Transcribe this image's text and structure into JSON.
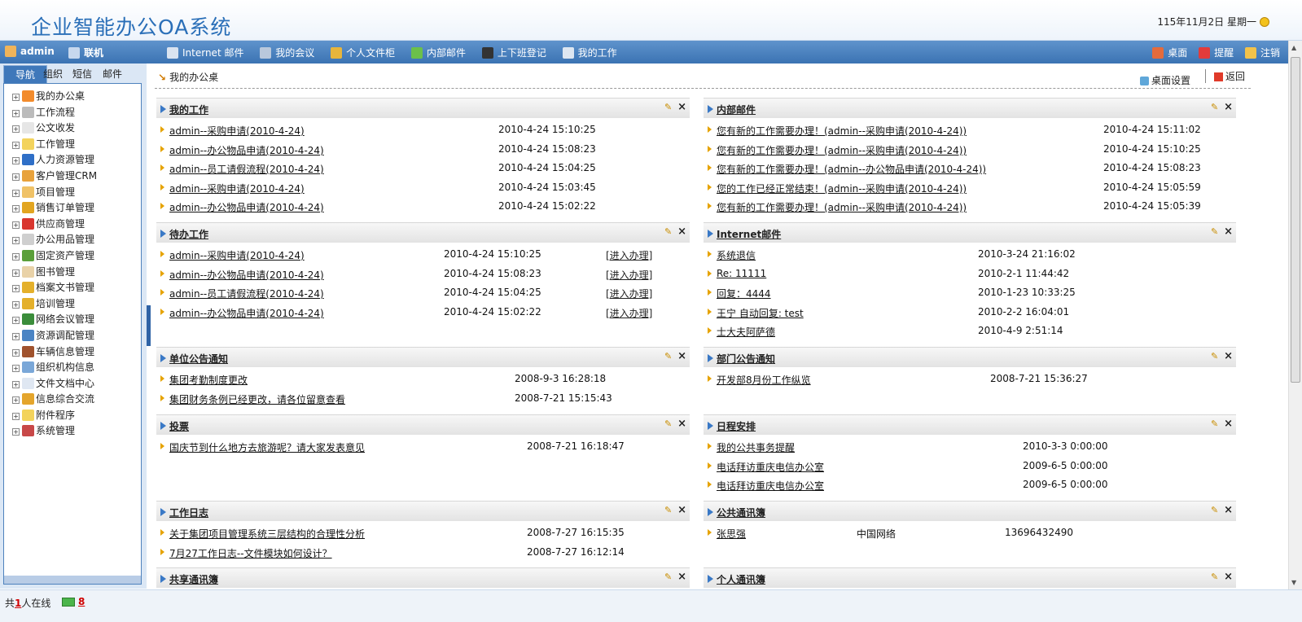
{
  "header": {
    "title": "企业智能办公OA系统",
    "date": "115年11月2日 星期一"
  },
  "topbar": {
    "user": "admin",
    "status": "联机",
    "menu": [
      "Internet 邮件",
      "我的会议",
      "个人文件柜",
      "内部邮件",
      "上下班登记",
      "我的工作"
    ],
    "right": [
      "桌面",
      "提醒",
      "注销"
    ]
  },
  "left": {
    "tabs": [
      "导航",
      "组织",
      "短信",
      "邮件"
    ],
    "tree": [
      "我的办公桌",
      "工作流程",
      "公文收发",
      "工作管理",
      "人力资源管理",
      "客户管理CRM",
      "项目管理",
      "销售订单管理",
      "供应商管理",
      "办公用品管理",
      "固定资产管理",
      "图书管理",
      "档案文书管理",
      "培训管理",
      "网络会议管理",
      "资源调配管理",
      "车辆信息管理",
      "组织机构信息",
      "文件文档中心",
      "信息综合交流",
      "附件程序",
      "系统管理"
    ]
  },
  "main": {
    "breadcrumb": "我的办公桌",
    "desk_settings": "桌面设置",
    "back": "返回",
    "blocks": {
      "my_work": {
        "title": "我的工作",
        "rows": [
          {
            "t": "admin--采购申请(2010-4-24)",
            "d": "2010-4-24 15:10:25"
          },
          {
            "t": "admin--办公物品申请(2010-4-24)",
            "d": "2010-4-24 15:08:23"
          },
          {
            "t": "admin--员工请假流程(2010-4-24)",
            "d": "2010-4-24 15:04:25"
          },
          {
            "t": "admin--采购申请(2010-4-24)",
            "d": "2010-4-24 15:03:45"
          },
          {
            "t": "admin--办公物品申请(2010-4-24)",
            "d": "2010-4-24 15:02:22"
          }
        ]
      },
      "internal_mail": {
        "title": "内部邮件",
        "rows": [
          {
            "t": "您有新的工作需要办理！(admin--采购申请(2010-4-24))",
            "d": "2010-4-24 15:11:02"
          },
          {
            "t": "您有新的工作需要办理！(admin--采购申请(2010-4-24))",
            "d": "2010-4-24 15:10:25"
          },
          {
            "t": "您有新的工作需要办理！(admin--办公物品申请(2010-4-24))",
            "d": "2010-4-24 15:08:23"
          },
          {
            "t": "您的工作已经正常结束！(admin--采购申请(2010-4-24))",
            "d": "2010-4-24 15:05:59"
          },
          {
            "t": "您有新的工作需要办理！(admin--采购申请(2010-4-24))",
            "d": "2010-4-24 15:05:39"
          }
        ]
      },
      "todo": {
        "title": "待办工作",
        "action": "[进入办理]",
        "rows": [
          {
            "t": "admin--采购申请(2010-4-24)",
            "d": "2010-4-24 15:10:25"
          },
          {
            "t": "admin--办公物品申请(2010-4-24)",
            "d": "2010-4-24 15:08:23"
          },
          {
            "t": "admin--员工请假流程(2010-4-24)",
            "d": "2010-4-24 15:04:25"
          },
          {
            "t": "admin--办公物品申请(2010-4-24)",
            "d": "2010-4-24 15:02:22"
          }
        ]
      },
      "internet_mail": {
        "title": "Internet邮件",
        "rows": [
          {
            "t": "系统退信",
            "d": "2010-3-24 21:16:02"
          },
          {
            "t": "Re: 11111",
            "d": "2010-2-1 11:44:42"
          },
          {
            "t": "回复：4444",
            "d": "2010-1-23 10:33:25"
          },
          {
            "t": "王宁 自动回复: test",
            "d": "2010-2-2 16:04:01"
          },
          {
            "t": "士大夫阿萨德",
            "d": "2010-4-9 2:51:14"
          }
        ]
      },
      "unit_notice": {
        "title": "单位公告通知",
        "rows": [
          {
            "t": "集团考勤制度更改",
            "d": "2008-9-3 16:28:18"
          },
          {
            "t": "集团财务条例已经更改，请各位留意查看",
            "d": "2008-7-21 15:15:43"
          }
        ]
      },
      "dept_notice": {
        "title": "部门公告通知",
        "rows": [
          {
            "t": "开发部8月份工作纵览",
            "d": "2008-7-21 15:36:27"
          }
        ]
      },
      "vote": {
        "title": "投票",
        "rows": [
          {
            "t": "国庆节到什么地方去旅游呢？请大家发表意见",
            "d": "2008-7-21 16:18:47"
          }
        ]
      },
      "schedule": {
        "title": "日程安排",
        "rows": [
          {
            "t": "我的公共事务提醒",
            "d": "2010-3-3 0:00:00"
          },
          {
            "t": "电话拜访重庆电信办公室",
            "d": "2009-6-5 0:00:00"
          },
          {
            "t": "电话拜访重庆电信办公室",
            "d": "2009-6-5 0:00:00"
          }
        ]
      },
      "work_log": {
        "title": "工作日志",
        "rows": [
          {
            "t": "关于集团项目管理系统三层结构的合理性分析",
            "d": "2008-7-27 16:15:35"
          },
          {
            "t": "7月27工作日志--文件模块如何设计？",
            "d": "2008-7-27 16:12:14"
          }
        ]
      },
      "public_contacts": {
        "title": "公共通讯簿",
        "rows": [
          {
            "t": "张思强",
            "c": "中国网络",
            "p": "13696432490"
          }
        ]
      },
      "shared_contacts": {
        "title": "共享通讯簿"
      },
      "personal_contacts": {
        "title": "个人通讯簿"
      }
    }
  },
  "status": {
    "prefix": "共",
    "online_count": "1",
    "suffix": "人在线",
    "mail_count": "8"
  },
  "colors": {
    "brand": "#2a6fb8",
    "topbar": "#3b73b3",
    "bullet": "#e6a300"
  }
}
